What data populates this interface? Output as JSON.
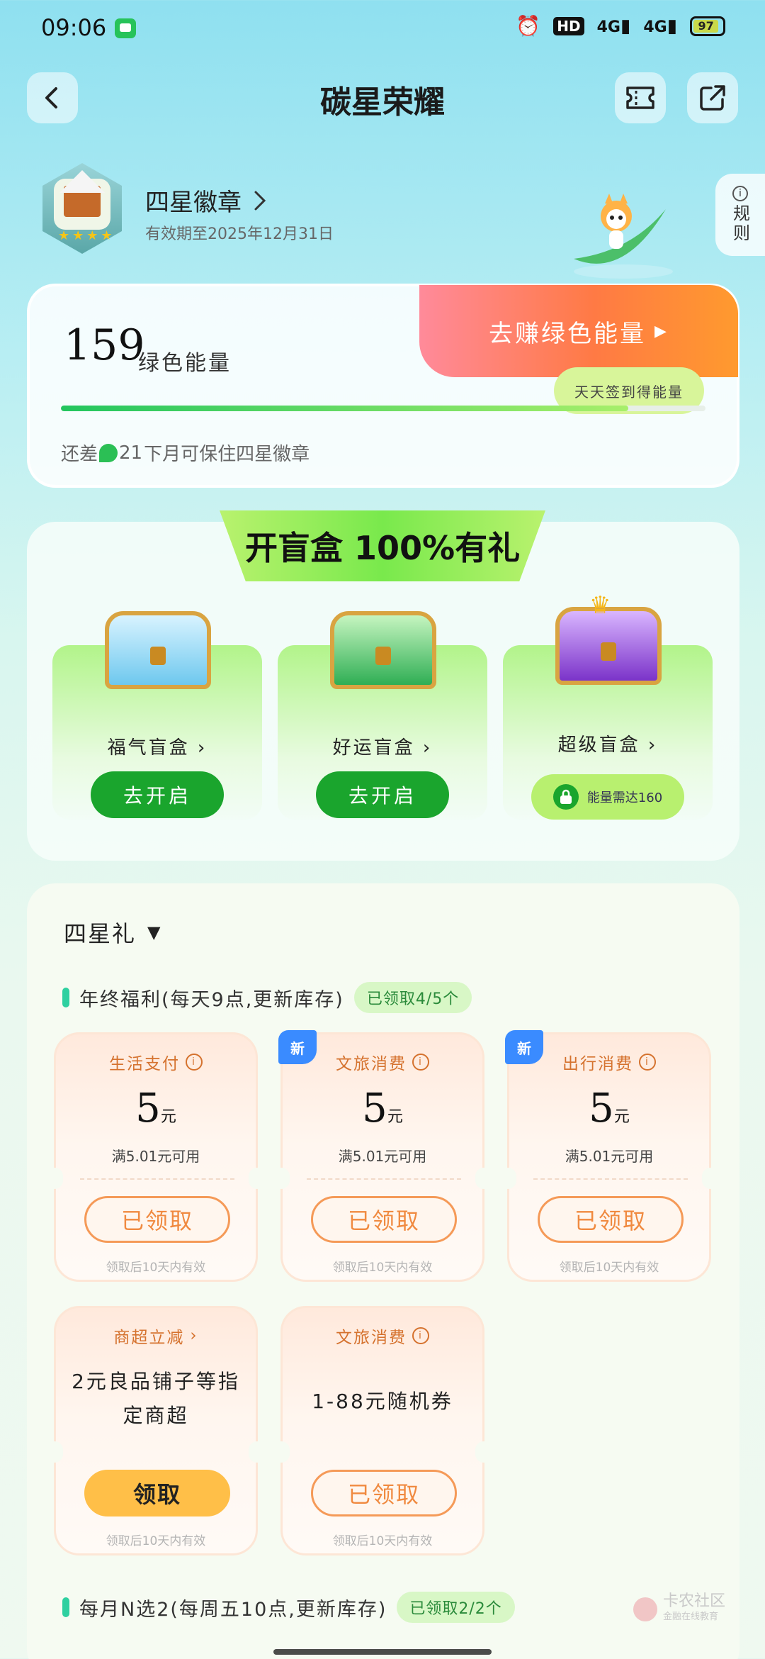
{
  "status_bar": {
    "time": "09:06",
    "network_hd": "HD",
    "signal_1": "4G",
    "signal_2": "4G",
    "battery": "97"
  },
  "nav": {
    "title": "碳星荣耀"
  },
  "badge": {
    "name": "四星徽章",
    "valid_until": "有效期至2025年12月31日"
  },
  "rule_tab": {
    "label": "规则"
  },
  "energy": {
    "value": "159",
    "label": "绿色能量",
    "cta_label": "去赚绿色能量",
    "cta_sub": "天天签到得能量",
    "progress_fraction": 0.88,
    "hint_prefix": "还差",
    "hint_amount": "21",
    "hint_suffix": "下月可保住四星徽章"
  },
  "blind_boxes": {
    "title": "开盲盒 100%有礼",
    "items": [
      {
        "name": "福气盲盒",
        "action": "去开启",
        "color": "#7fd3f0"
      },
      {
        "name": "好运盲盒",
        "action": "去开启",
        "color": "#44c26a"
      },
      {
        "name": "超级盲盒",
        "locked_text": "能量需达160",
        "color": "#9a4de0"
      }
    ]
  },
  "rewards": {
    "tier_selector": "四星礼",
    "group1": {
      "title": "年终福利(每天9点,更新库存)",
      "status": "已领取4/5个",
      "coupons": [
        {
          "category": "生活支付",
          "amount": "5",
          "unit": "元",
          "condition": "满5.01元可用",
          "button": "已领取",
          "foot": "领取后10天内有效",
          "is_new": false
        },
        {
          "category": "文旅消费",
          "amount": "5",
          "unit": "元",
          "condition": "满5.01元可用",
          "button": "已领取",
          "foot": "领取后10天内有效",
          "is_new": true
        },
        {
          "category": "出行消费",
          "amount": "5",
          "unit": "元",
          "condition": "满5.01元可用",
          "button": "已领取",
          "foot": "领取后10天内有效",
          "is_new": true
        },
        {
          "category": "商超立减",
          "desc": "2元良品铺子等指定商超",
          "button": "领取",
          "foot": "领取后10天内有效",
          "is_new": false
        },
        {
          "category": "文旅消费",
          "desc": "1-88元随机券",
          "button": "已领取",
          "foot": "领取后10天内有效",
          "is_new": false
        }
      ]
    },
    "group2": {
      "title": "每月N选2(每周五10点,更新库存)",
      "status": "已领取2/2个"
    },
    "new_tag": "新"
  },
  "watermark": {
    "title": "卡农社区",
    "sub": "金融在线教育"
  }
}
